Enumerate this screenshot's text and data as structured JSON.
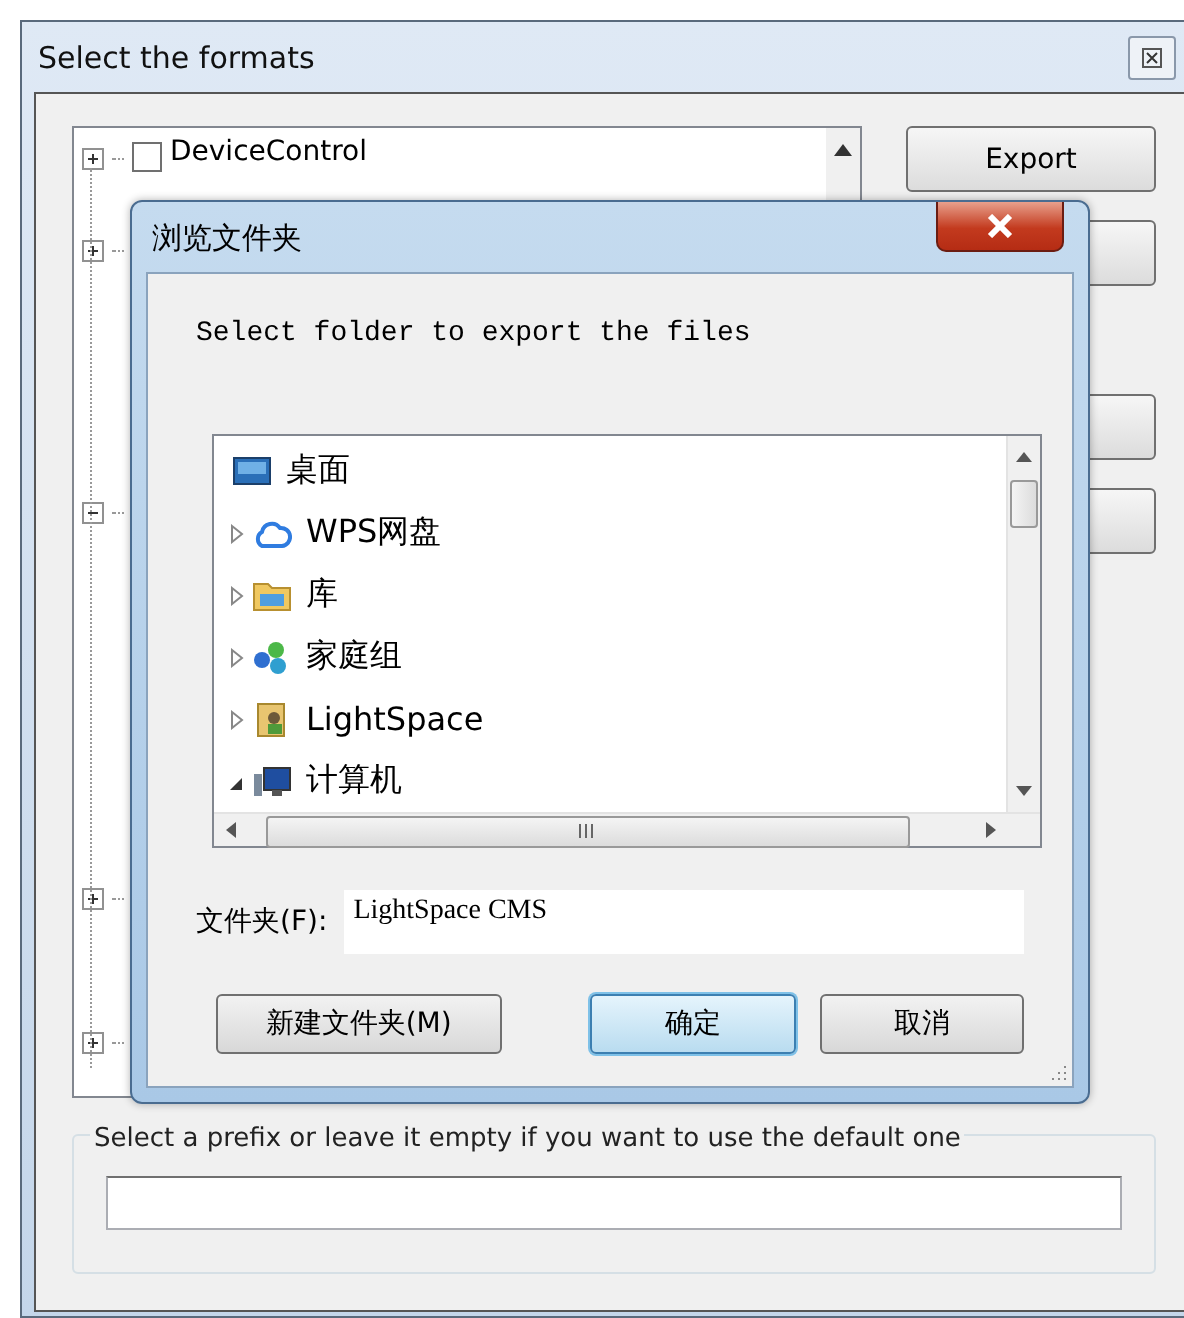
{
  "main_window": {
    "title": "Select the formats",
    "tree": {
      "items": [
        {
          "label": "DeviceControl",
          "checked": false,
          "expanded": false
        },
        {
          "expanded": false
        },
        {
          "expanded": true
        },
        {
          "expanded": false
        },
        {
          "expanded": false
        }
      ]
    },
    "buttons": [
      "Export"
    ],
    "prefix": {
      "label": "Select a prefix or leave it empty if you want to use the default one"
    }
  },
  "dialog": {
    "title": "浏览文件夹",
    "prompt": "Select folder to export the files",
    "folders": [
      {
        "label": "桌面",
        "kind": "desktop"
      },
      {
        "label": "WPS网盘",
        "kind": "cloud",
        "expanded": false
      },
      {
        "label": "库",
        "kind": "library",
        "expanded": false
      },
      {
        "label": "家庭组",
        "kind": "homegroup",
        "expanded": false
      },
      {
        "label": "LightSpace",
        "kind": "user",
        "expanded": false
      },
      {
        "label": "计算机",
        "kind": "computer",
        "expanded": true
      }
    ],
    "folder_label": "文件夹(F):",
    "folder_value": "LightSpace CMS",
    "buttons": [
      {
        "label": "新建文件夹(M)",
        "selected": false
      },
      {
        "label": "确定",
        "selected": true
      },
      {
        "label": "取消",
        "selected": false
      }
    ]
  }
}
